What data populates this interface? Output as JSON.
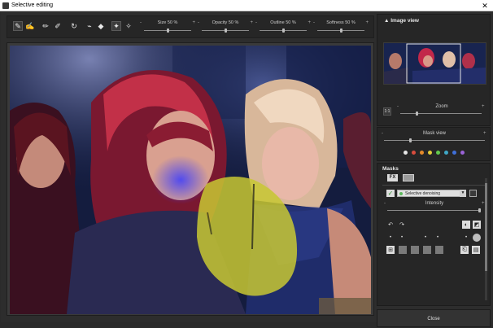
{
  "window": {
    "title": "Selective editing",
    "close_glyph": "✕"
  },
  "toolbar": {
    "sliders": [
      {
        "label": "Size",
        "value": "50",
        "unit": "%",
        "level": 0.5
      },
      {
        "label": "Opacity",
        "value": "50",
        "unit": "%",
        "level": 0.5
      },
      {
        "label": "Outline",
        "value": "50",
        "unit": "%",
        "level": 0.5
      },
      {
        "label": "Softness",
        "value": "50",
        "unit": "%",
        "level": 0.5
      }
    ],
    "minus": "-",
    "plus": "+"
  },
  "image_view": {
    "header": "Image view",
    "zoom_label": "Zoom",
    "zoom_button": "1:1",
    "mask_view_label": "Mask view",
    "dot_colors": [
      "#e6e6e6",
      "#d94c3d",
      "#e58a2a",
      "#e3cf3a",
      "#63c94d",
      "#3fa7c6",
      "#3f6fd8",
      "#9a63d6"
    ]
  },
  "masks": {
    "header": "Masks",
    "fx_label": "FX",
    "mask_name": "Selective denoising",
    "intensity_label": "Intensity"
  },
  "footer": {
    "close_label": "Close"
  },
  "colors": {
    "mask_overlay": "#c8c832",
    "accent_check": "#5cb85c"
  }
}
